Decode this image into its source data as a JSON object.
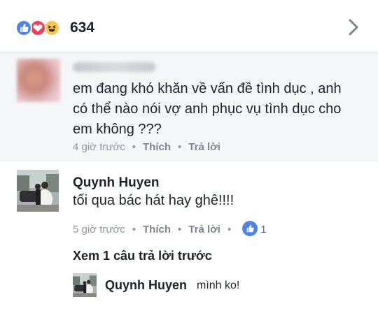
{
  "header": {
    "reactions": [
      "like-icon",
      "love-icon",
      "haha-icon"
    ],
    "reaction_count": "634",
    "colors": {
      "like": "#4f83ea",
      "love": "#f0405e",
      "haha": "#f7c948"
    }
  },
  "comments": [
    {
      "author": "",
      "text_lines": [
        "em đang khó khăn về vấn đề tình dục , anh",
        "có thể nào nói vợ anh phục vụ tình dục cho",
        "em không ???"
      ],
      "time": "4 giờ trước",
      "like_label": "Thích",
      "reply_label": "Trả lời"
    },
    {
      "author": "Quynh Huyen",
      "text": "tối qua bác hát hay ghê!!!!",
      "time": "5 giờ trước",
      "like_label": "Thích",
      "reply_label": "Trả lời",
      "like_count": "1"
    }
  ],
  "view_previous": "Xem 1 câu trả lời trước",
  "reply": {
    "author": "Quynh Huyen",
    "text": "mình ko!"
  }
}
